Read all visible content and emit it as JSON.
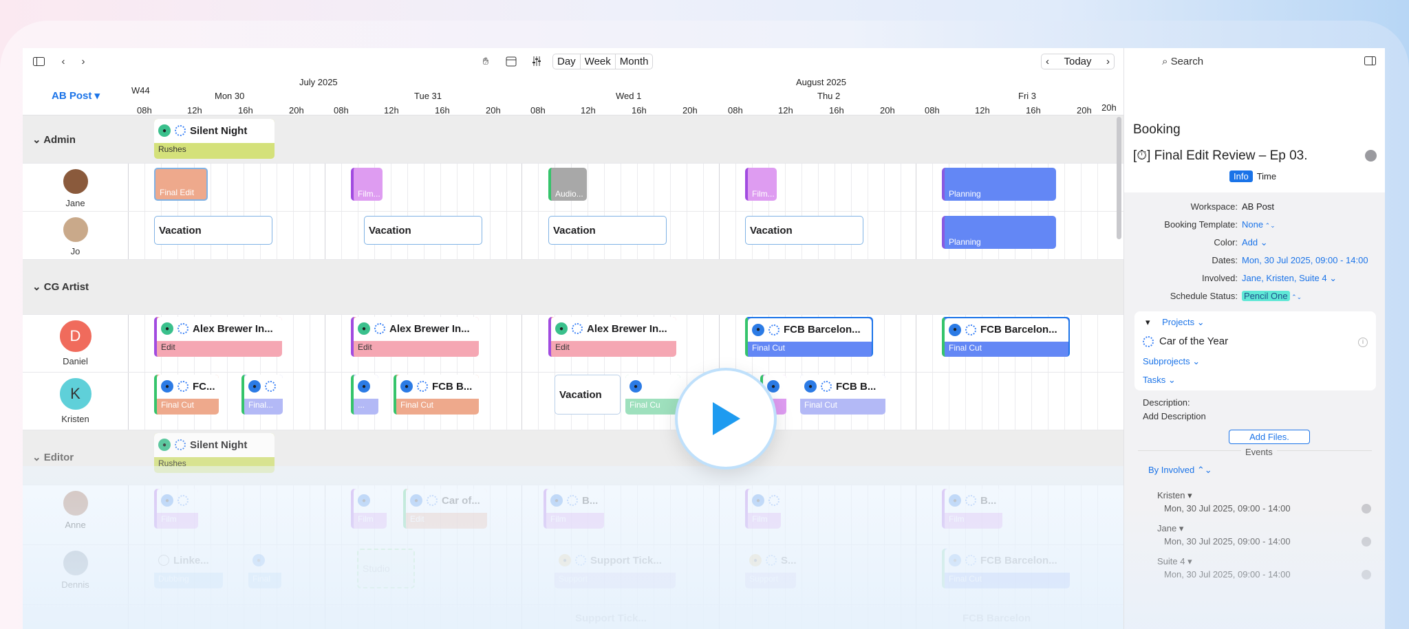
{
  "toolbar": {
    "views": [
      "Day",
      "Week",
      "Month"
    ],
    "today": "Today"
  },
  "calendar": {
    "workspace": "AB Post",
    "week": "W44",
    "months": [
      "July 2025",
      "August 2025"
    ],
    "days": [
      "Mon 30",
      "Tue 31",
      "Wed 1",
      "Thu 2",
      "Fri 3"
    ],
    "hours": [
      "08h",
      "12h",
      "16h",
      "20h"
    ],
    "last_hour": "20h",
    "groups": [
      "Admin",
      "CG Artist",
      "Editor"
    ],
    "people": {
      "jane": "Jane",
      "jo": "Jo",
      "daniel": "Daniel",
      "daniel_initial": "D",
      "kristen": "Kristen",
      "kristen_initial": "K",
      "anne": "Anne",
      "dennis": "Dennis"
    },
    "events": {
      "silent_night": "Silent Night",
      "rushes": "Rushes",
      "final_edit": "Final Edit",
      "film_ellipsis": "Film...",
      "audio_ellipsis": "Audio...",
      "planning": "Planning",
      "vacation": "Vacation",
      "alex": "Alex Brewer In...",
      "edit": "Edit",
      "fcb": "FCB Barcelon...",
      "final_cut": "Final Cut",
      "fc_short": "FC...",
      "final_short": "Final...",
      "fcb_b": "FCB B...",
      "ellipsis": "...",
      "final_cu": "Final Cu",
      "film": "Film",
      "car_of": "Car of...",
      "b_short": "B...",
      "linked": "Linke...",
      "dubbing": "Dubbing",
      "final": "Final",
      "studio": "Studio",
      "support_ticket": "Support Tick...",
      "support": "Support",
      "s_short": "S...",
      "fcb_long": "FCB Barcelon...",
      "fcb_faded": "FCB Barcelon"
    }
  },
  "panel": {
    "search": "Search",
    "title": "Booking",
    "booking_name": "Final Edit Review – Ep 03.",
    "tabs": [
      "Info",
      "Time"
    ],
    "fields": [
      {
        "k": "Workspace:",
        "v": "AB Post"
      },
      {
        "k": "Booking Template:",
        "v": "None"
      },
      {
        "k": "Color:",
        "v": "Add"
      },
      {
        "k": "Dates:",
        "v": "Mon, 30 Jul 2025, 09:00 - 14:00"
      },
      {
        "k": "Involved:",
        "v": "Jane, Kristen, Suite 4"
      },
      {
        "k": "Schedule Status:",
        "v": "Pencil One"
      }
    ],
    "projects_label": "Projects",
    "project": "Car of the Year",
    "subprojects": "Subprojects",
    "tasks": "Tasks",
    "description_label": "Description:",
    "description_placeholder": "Add Description",
    "add_files": "Add Files.",
    "events_label": "Events",
    "by_involved": "By Involved",
    "event_groups": [
      {
        "name": "Kristen",
        "date": "Mon, 30 Jul 2025, 09:00 - 14:00"
      },
      {
        "name": "Jane",
        "date": "Mon, 30 Jul 2025, 09:00 - 14:00"
      },
      {
        "name": "Suite 4",
        "date": "Mon, 30 Jul 2025, 09:00 - 14:00"
      }
    ]
  },
  "colors": {
    "accent": "#1a73e8",
    "green": "#d4e17a",
    "salmon": "#eea98c",
    "violet": "#de9cf1",
    "blue": "#6387f5",
    "pink": "#f5a7b3",
    "periwinkle": "#b3b9f6",
    "mint": "#9ee0bd"
  }
}
